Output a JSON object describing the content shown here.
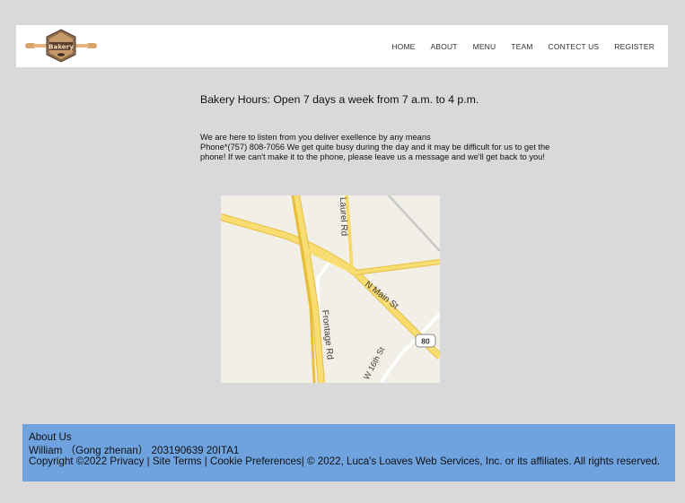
{
  "nav": {
    "logo_text": "Bakery",
    "items": [
      {
        "label": "HOME"
      },
      {
        "label": "ABOUT"
      },
      {
        "label": "MENU"
      },
      {
        "label": "TEAM"
      },
      {
        "label": "CONTECT US"
      },
      {
        "label": "REGISTER"
      }
    ]
  },
  "main": {
    "hours": "Bakery Hours: Open 7 days a week from 7 a.m. to 4 p.m.",
    "listen_line1": "We are here to listen from you deliver exellence by any means",
    "listen_line2": "Phone*(757) 808-7056 We get quite busy during the day and it may be difficult for us to get the phone! If we can't make it to the phone, please leave us a message and we'll get back to you!"
  },
  "map": {
    "labels": {
      "laurel": "Laurel Rd",
      "main_st": "N Main St",
      "frontage": "Frontage Rd",
      "w16": "W 16th St",
      "route": "80"
    }
  },
  "footer": {
    "about": "About Us",
    "author": "William  （Gong zhenan）  203190639  20ITA1",
    "copyright": "Copyright ©2022",
    "privacy": "Privacy",
    "sep1": "|",
    "site_terms": "Site Terms",
    "sep2": "|",
    "cookie": "Cookie Preferences",
    "rights": "| © 2022, Luca's Loaves Web Services, Inc. or its affiliates. All rights reserved."
  },
  "colors": {
    "page_bg": "#d9d9d9",
    "footer_bg": "#6fa3e0",
    "road_yellow": "#f6d86b",
    "map_bg": "#f1efe6"
  }
}
